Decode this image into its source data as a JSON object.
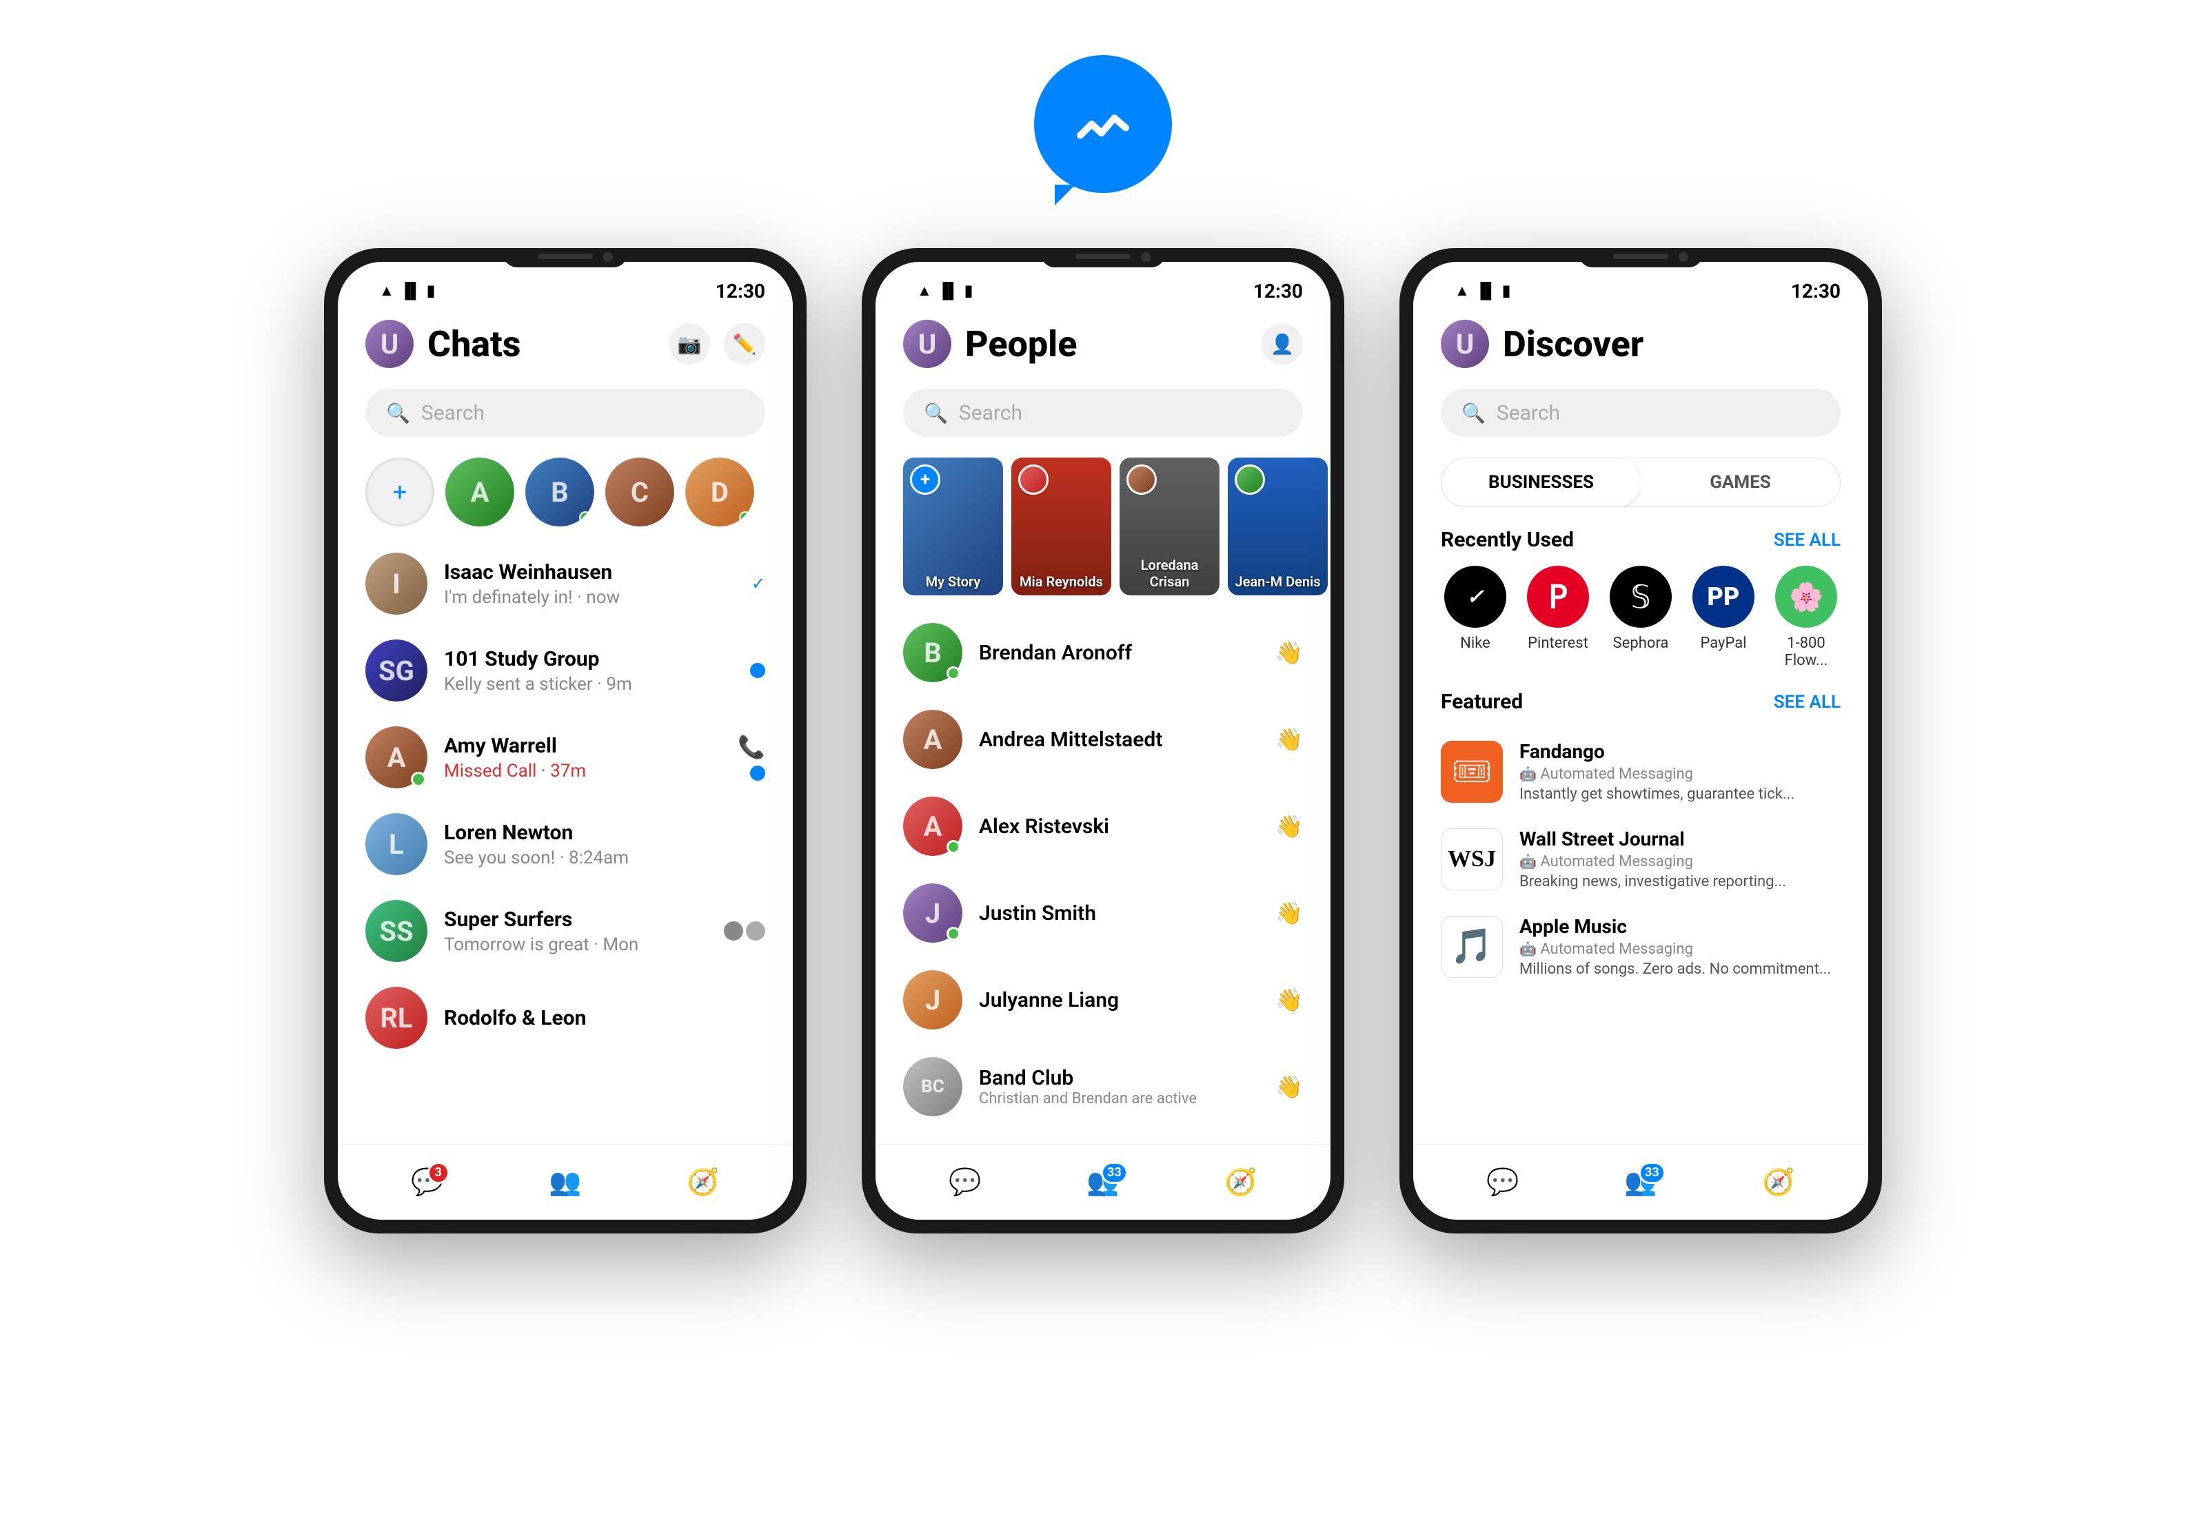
{
  "logo": {
    "alt": "Facebook Messenger Logo"
  },
  "phone1": {
    "statusBar": {
      "time": "12:30"
    },
    "header": {
      "title": "Chats",
      "cameraIcon": "📷",
      "editIcon": "✏️"
    },
    "search": {
      "placeholder": "Search"
    },
    "chats": [
      {
        "name": "Isaac Weinhausen",
        "preview": "I'm definately in! · now",
        "metaType": "check"
      },
      {
        "name": "101 Study Group",
        "preview": "Kelly sent a sticker · 9m",
        "metaType": "dot-blue"
      },
      {
        "name": "Amy Warrell",
        "preview": "Missed Call · 37m",
        "metaType": "phone",
        "missedCall": true
      },
      {
        "name": "Loren Newton",
        "preview": "See you soon! · 8:24am",
        "metaType": "none"
      },
      {
        "name": "Super Surfers",
        "preview": "Tomorrow is great · Mon",
        "metaType": "none"
      },
      {
        "name": "Rodolfo & Leon",
        "preview": "",
        "metaType": "none"
      }
    ],
    "bottomNav": [
      {
        "icon": "💬",
        "active": true,
        "badge": "3",
        "badgeType": "red"
      },
      {
        "icon": "👥",
        "active": false
      },
      {
        "icon": "🧭",
        "active": false
      }
    ]
  },
  "phone2": {
    "statusBar": {
      "time": "12:30"
    },
    "header": {
      "title": "People",
      "addPersonIcon": "👤+"
    },
    "search": {
      "placeholder": "Search"
    },
    "stories": [
      {
        "label": "My Story",
        "type": "add"
      },
      {
        "label": "Mia Reynolds",
        "type": "story",
        "color": "sc-red"
      },
      {
        "label": "Loredana Crisan",
        "type": "story",
        "color": "sc-gray"
      },
      {
        "label": "Jean-M Denis",
        "type": "story",
        "color": "sc-blue"
      }
    ],
    "people": [
      {
        "name": "Brendan Aronoff",
        "online": true
      },
      {
        "name": "Andrea Mittelstaedt",
        "online": false
      },
      {
        "name": "Alex Ristevski",
        "online": true
      },
      {
        "name": "Justin Smith",
        "online": true
      },
      {
        "name": "Julyanne Liang",
        "online": false
      },
      {
        "name": "Band Club",
        "online": false,
        "preview": "Christian and Brendan are active"
      }
    ],
    "bottomNav": [
      {
        "icon": "💬",
        "active": false
      },
      {
        "icon": "👥",
        "active": true,
        "badge": "33",
        "badgeType": "blue"
      },
      {
        "icon": "🧭",
        "active": false
      }
    ]
  },
  "phone3": {
    "statusBar": {
      "time": "12:30"
    },
    "header": {
      "title": "Discover"
    },
    "search": {
      "placeholder": "Search"
    },
    "tabs": [
      {
        "label": "BUSINESSES",
        "active": true
      },
      {
        "label": "GAMES",
        "active": false
      }
    ],
    "recentlyUsed": {
      "title": "Recently Used",
      "seeAll": "SEE ALL",
      "items": [
        {
          "label": "Nike",
          "color": "#000000"
        },
        {
          "label": "Pinterest",
          "color": "#E60023"
        },
        {
          "label": "Sephora",
          "color": "#000000"
        },
        {
          "label": "PayPal",
          "color": "#003087"
        },
        {
          "label": "1-800 Flow...",
          "color": "#40c060"
        }
      ]
    },
    "featured": {
      "title": "Featured",
      "seeAll": "SEE ALL",
      "items": [
        {
          "name": "Fandango",
          "sub": "Automated Messaging",
          "desc": "Instantly get showtimes, guarantee tick...",
          "color": "#f06020"
        },
        {
          "name": "Wall Street Journal",
          "sub": "Automated Messaging",
          "desc": "Breaking news, investigative reporting...",
          "color": "#ffffff",
          "textColor": "#000000"
        },
        {
          "name": "Apple Music",
          "sub": "Automated Messaging",
          "desc": "Millions of songs. Zero ads. No commitment...",
          "color": "#ff2d55"
        }
      ]
    },
    "bottomNav": [
      {
        "icon": "💬",
        "active": false
      },
      {
        "icon": "👥",
        "active": false,
        "badge": "33",
        "badgeType": "blue"
      },
      {
        "icon": "🧭",
        "active": true
      }
    ]
  }
}
